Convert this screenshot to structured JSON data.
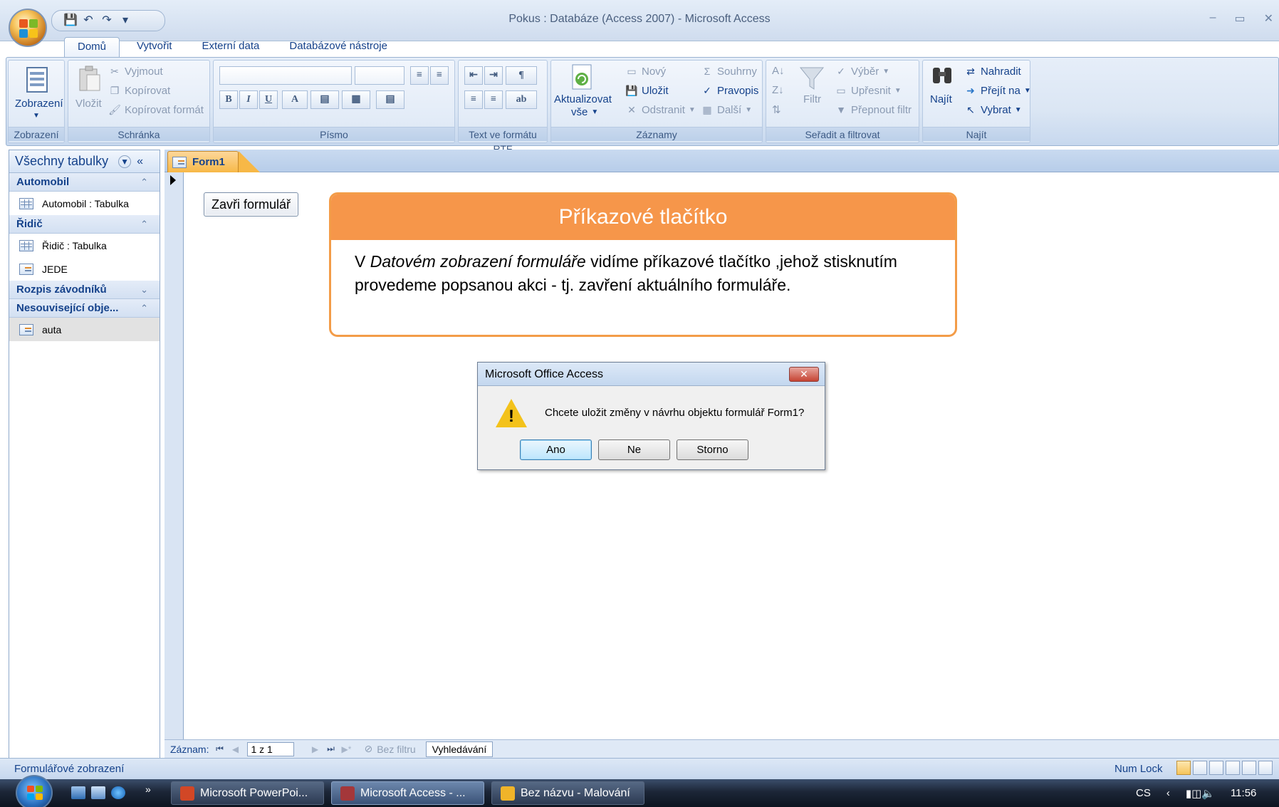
{
  "window": {
    "title": "Pokus : Databáze (Access 2007) - Microsoft Access",
    "controls": [
      "–",
      "▭",
      "✕"
    ]
  },
  "ribbon_tabs": [
    "Domů",
    "Vytvořit",
    "Externí data",
    "Databázové nástroje"
  ],
  "ribbon": {
    "groups": {
      "zobrazeni": "Zobrazení",
      "schranka": "Schránka",
      "pismo": "Písmo",
      "rtf": "Text ve formátu RTF",
      "zaznamy": "Záznamy",
      "seradit": "Seřadit a filtrovat",
      "najit": "Najít"
    },
    "buttons": {
      "zobrazeni": "Zobrazení",
      "vlozit": "Vložit",
      "vyjmout": "Vyjmout",
      "kopirovat": "Kopírovat",
      "kopirovat_format": "Kopírovat formát",
      "aktualizovat": "Aktualizovat",
      "aktualizovat2": "vše",
      "nove": "Nový",
      "ulozit": "Uložit",
      "odstranit": "Odstranit",
      "souhrny": "Souhrny",
      "pravopis": "Pravopis",
      "dalsi": "Další",
      "filtr": "Filtr",
      "vyber": "Výběr",
      "upresnit": "Upřesnit",
      "prepnout_filtr": "Přepnout filtr",
      "najit": "Najít",
      "nahradit": "Nahradit",
      "prejit_na": "Přejít na",
      "vybrat": "Vybrat"
    }
  },
  "nav_pane": {
    "header": "Všechny tabulky",
    "categories": [
      {
        "name": "Automobil",
        "items": [
          "Automobil : Tabulka"
        ]
      },
      {
        "name": "Řidič",
        "items": [
          "Řidič : Tabulka",
          "JEDE"
        ]
      },
      {
        "name": "Rozpis závodníků",
        "items": []
      },
      {
        "name": "Nesouvisející obje...",
        "items": [
          "auta"
        ]
      }
    ]
  },
  "document": {
    "tab": "Form1",
    "close_button": "Zavři formulář"
  },
  "callout": {
    "title": "Příkazové tlačítko",
    "text_before": "V ",
    "text_italic": "Datovém zobrazení formuláře",
    "text_after": " vidíme příkazové tlačítko ,jehož stisknutím provedeme popsanou akci - tj. zavření aktuálního formuláře."
  },
  "dialog": {
    "title": "Microsoft Office Access",
    "message": "Chcete uložit změny v návrhu objektu formulář Form1?",
    "buttons": [
      "Ano",
      "Ne",
      "Storno"
    ]
  },
  "record_nav": {
    "label": "Záznam:",
    "position": "1 z 1",
    "filter": "Bez filtru",
    "search": "Vyhledávání"
  },
  "status": {
    "left": "Formulářové zobrazení",
    "numlock": "Num Lock"
  },
  "taskbar": {
    "tasks": [
      "Microsoft PowerPoi...",
      "Microsoft Access - ...",
      "Bez názvu - Malování"
    ],
    "lang": "CS",
    "time": "11:56"
  },
  "colors": {
    "callout_accent": "#f6964a",
    "ribbon_text": "#15428b",
    "active_tab": "#f7b847"
  }
}
